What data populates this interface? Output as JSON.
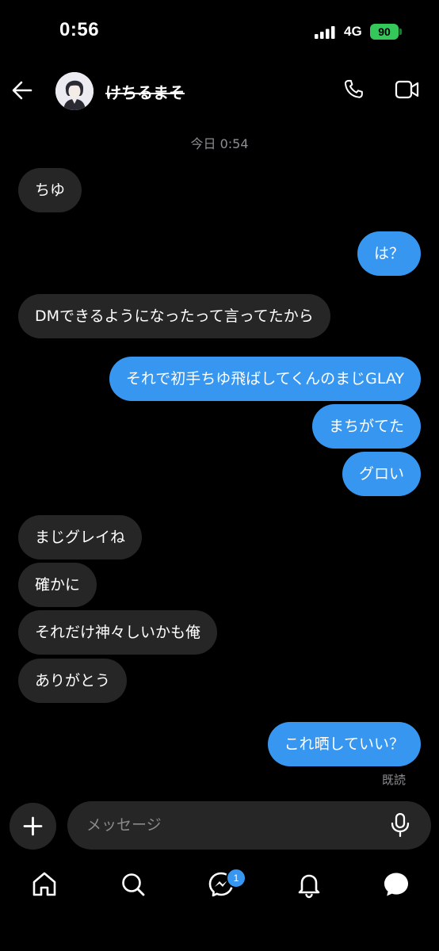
{
  "status_bar": {
    "time": "0:56",
    "network": "4G",
    "battery": "90"
  },
  "header": {
    "contact_name": "けちるまそ"
  },
  "conversation": {
    "timestamp": "今日 0:54",
    "messages": [
      {
        "side": "in",
        "text": "ちゆ"
      },
      {
        "side": "out",
        "text": "は？"
      },
      {
        "side": "in",
        "text": "DMできるようになったって言ってたから"
      },
      {
        "side": "out",
        "text": "それで初手ちゆ飛ばしてくんのまじGLAY"
      },
      {
        "side": "out",
        "text": "まちがてた"
      },
      {
        "side": "out",
        "text": "グロい"
      },
      {
        "side": "in",
        "text": "まじグレイね"
      },
      {
        "side": "in",
        "text": "確かに"
      },
      {
        "side": "in",
        "text": "それだけ神々しいかも俺"
      },
      {
        "side": "in",
        "text": "ありがとう"
      },
      {
        "side": "out",
        "text": "これ晒していい？"
      }
    ],
    "read_receipt": "既読"
  },
  "composer": {
    "placeholder": "メッセージ"
  },
  "tab_bar": {
    "messages_badge": "1"
  },
  "colors": {
    "outgoing_bubble": "#3797f0",
    "incoming_bubble": "#262626",
    "battery": "#34c759"
  }
}
